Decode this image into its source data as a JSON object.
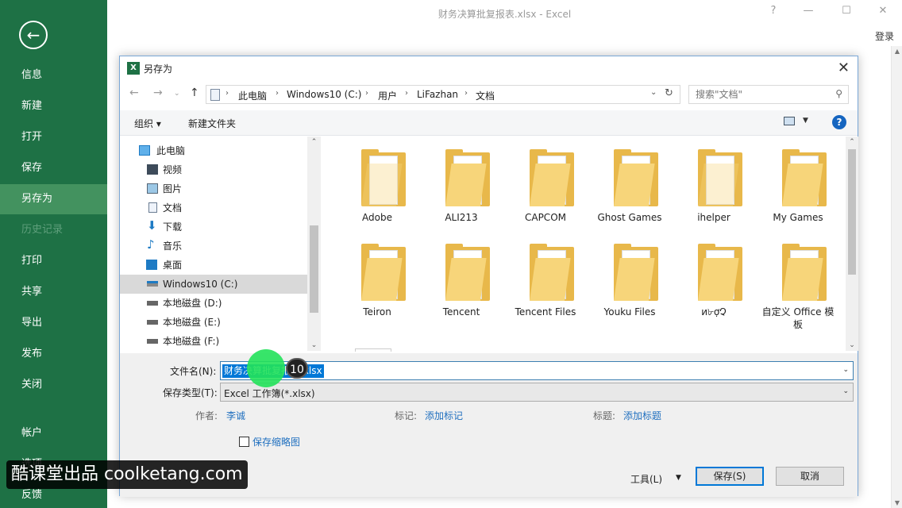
{
  "excel": {
    "title": "财务决算批复报表.xlsx - Excel",
    "help": "?",
    "login": "登录",
    "back_icon": "arrow-left-icon"
  },
  "sidebar": {
    "items": [
      {
        "label": "信息"
      },
      {
        "label": "新建"
      },
      {
        "label": "打开"
      },
      {
        "label": "保存"
      },
      {
        "label": "另存为",
        "active": true
      },
      {
        "label": "历史记录",
        "disabled": true
      },
      {
        "label": "打印"
      },
      {
        "label": "共享"
      },
      {
        "label": "导出"
      },
      {
        "label": "发布"
      },
      {
        "label": "关闭"
      },
      {
        "label": "帐户"
      },
      {
        "label": "选项"
      },
      {
        "label": "反馈"
      }
    ]
  },
  "dialog": {
    "title": "另存为",
    "breadcrumb": [
      "此电脑",
      "Windows10 (C:)",
      "用户",
      "LiFazhan",
      "文档"
    ],
    "search_placeholder": "搜索\"文档\"",
    "toolbar": {
      "organize": "组织 ▾",
      "new_folder": "新建文件夹"
    },
    "nav": [
      {
        "label": "此电脑",
        "icon": "computer-icon"
      },
      {
        "label": "视频",
        "icon": "video-icon"
      },
      {
        "label": "图片",
        "icon": "pictures-icon"
      },
      {
        "label": "文档",
        "icon": "documents-icon"
      },
      {
        "label": "下载",
        "icon": "download-icon"
      },
      {
        "label": "音乐",
        "icon": "music-icon"
      },
      {
        "label": "桌面",
        "icon": "desktop-icon"
      },
      {
        "label": "Windows10 (C:)",
        "icon": "windows-drive-icon",
        "selected": true
      },
      {
        "label": "本地磁盘 (D:)",
        "icon": "drive-icon"
      },
      {
        "label": "本地磁盘 (E:)",
        "icon": "drive-icon"
      },
      {
        "label": "本地磁盘 (F:)",
        "icon": "drive-icon"
      }
    ],
    "folders": [
      {
        "name": "Adobe"
      },
      {
        "name": "ALI213"
      },
      {
        "name": "CAPCOM"
      },
      {
        "name": "Ghost Games"
      },
      {
        "name": "ihelper"
      },
      {
        "name": "My Games"
      },
      {
        "name": "Teiron"
      },
      {
        "name": "Tencent"
      },
      {
        "name": "Tencent Files"
      },
      {
        "name": "Youku Files"
      },
      {
        "name": "и৮ợՉ"
      },
      {
        "name": "自定义 Office 模板"
      }
    ],
    "form": {
      "filename_label": "文件名(N):",
      "filename_value": "财务决算批复报表.xlsx",
      "filetype_label": "保存类型(T):",
      "filetype_value": "Excel 工作簿(*.xlsx)",
      "author_label": "作者:",
      "author_value": "李诚",
      "tags_label": "标记:",
      "tags_value": "添加标记",
      "title_label": "标题:",
      "title_value": "添加标题",
      "thumbnail_label": "保存缩略图",
      "tools": "工具(L)",
      "save": "保存(S)",
      "cancel": "取消"
    }
  },
  "overlay": {
    "step": "10",
    "watermark": "酷课堂出品 coolketang.com"
  },
  "colors": {
    "sidebar": "#1e7145",
    "sidebar_active": "#43925f",
    "selection": "#0078d7",
    "link": "#1f6fbf",
    "folder": "#e8b84a"
  }
}
